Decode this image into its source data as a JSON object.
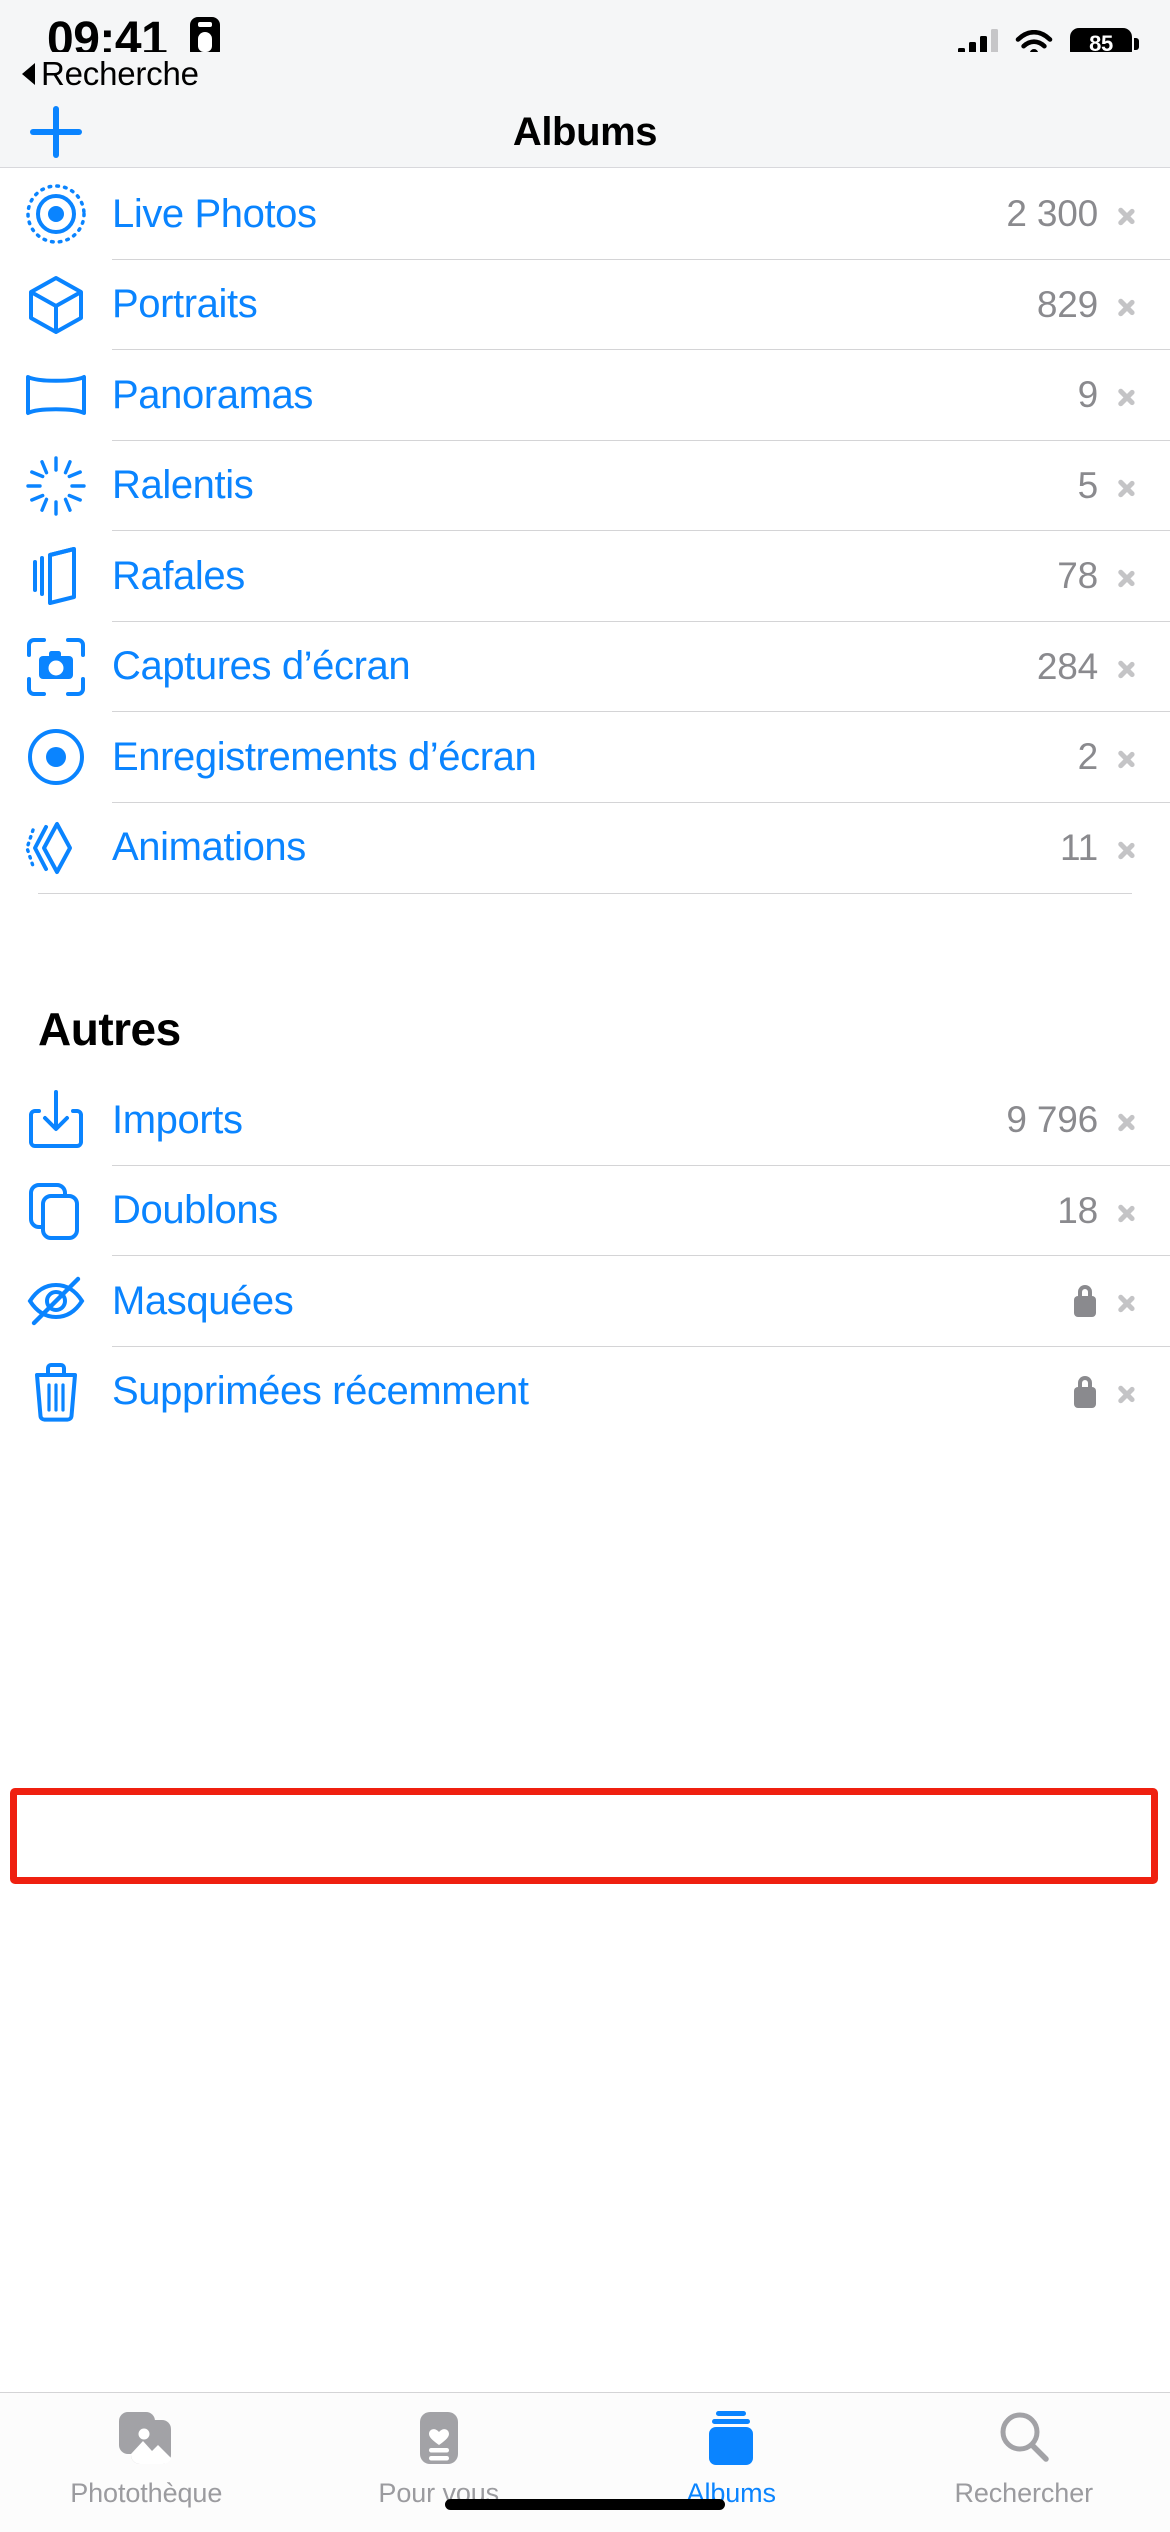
{
  "status_bar": {
    "time": "09:41",
    "recording_icon": "recording-indicator-icon",
    "signal_icon": "cellular-signal-icon",
    "wifi_icon": "wifi-icon",
    "battery_level": "85"
  },
  "back": {
    "label": "Recherche",
    "caret_icon": "back-caret-icon"
  },
  "navbar": {
    "title": "Albums",
    "add_icon": "plus-icon"
  },
  "albums": {
    "media_types": [
      {
        "label": "Live Photos",
        "count": "2 300",
        "icon": "live-photos-icon",
        "accessory": "count"
      },
      {
        "label": "Portraits",
        "count": "829",
        "icon": "cube-icon",
        "accessory": "count"
      },
      {
        "label": "Panoramas",
        "count": "9",
        "icon": "panorama-icon",
        "accessory": "count"
      },
      {
        "label": "Ralentis",
        "count": "5",
        "icon": "slow-motion-icon",
        "accessory": "count"
      },
      {
        "label": "Rafales",
        "count": "78",
        "icon": "burst-icon",
        "accessory": "count"
      },
      {
        "label": "Captures d’écran",
        "count": "284",
        "icon": "screenshot-camera-icon",
        "accessory": "count"
      },
      {
        "label": "Enregistrements d’écran",
        "count": "2",
        "icon": "screen-record-icon",
        "accessory": "count"
      },
      {
        "label": "Animations",
        "count": "11",
        "icon": "animated-icon",
        "accessory": "count"
      }
    ],
    "others_header": "Autres",
    "others": [
      {
        "label": "Imports",
        "count": "9 796",
        "icon": "import-download-icon",
        "accessory": "count"
      },
      {
        "label": "Doublons",
        "count": "18",
        "icon": "duplicate-icon",
        "accessory": "count",
        "highlighted": true
      },
      {
        "label": "Masquées",
        "count": "",
        "icon": "eye-slash-icon",
        "accessory": "lock"
      },
      {
        "label": "Supprimées récemment",
        "count": "",
        "icon": "trash-icon",
        "accessory": "lock"
      }
    ]
  },
  "tabbar": {
    "items": [
      {
        "label": "Photothèque",
        "icon": "photo-library-icon",
        "active": false
      },
      {
        "label": "Pour vous",
        "icon": "for-you-icon",
        "active": false
      },
      {
        "label": "Albums",
        "icon": "albums-icon",
        "active": true
      },
      {
        "label": "Rechercher",
        "icon": "search-magnifier-icon",
        "active": false
      }
    ]
  },
  "colors": {
    "accent": "#0a84ff",
    "highlight": "#ef2010",
    "secondary_text": "#8a8a8e",
    "separator": "#d4d4d6"
  }
}
